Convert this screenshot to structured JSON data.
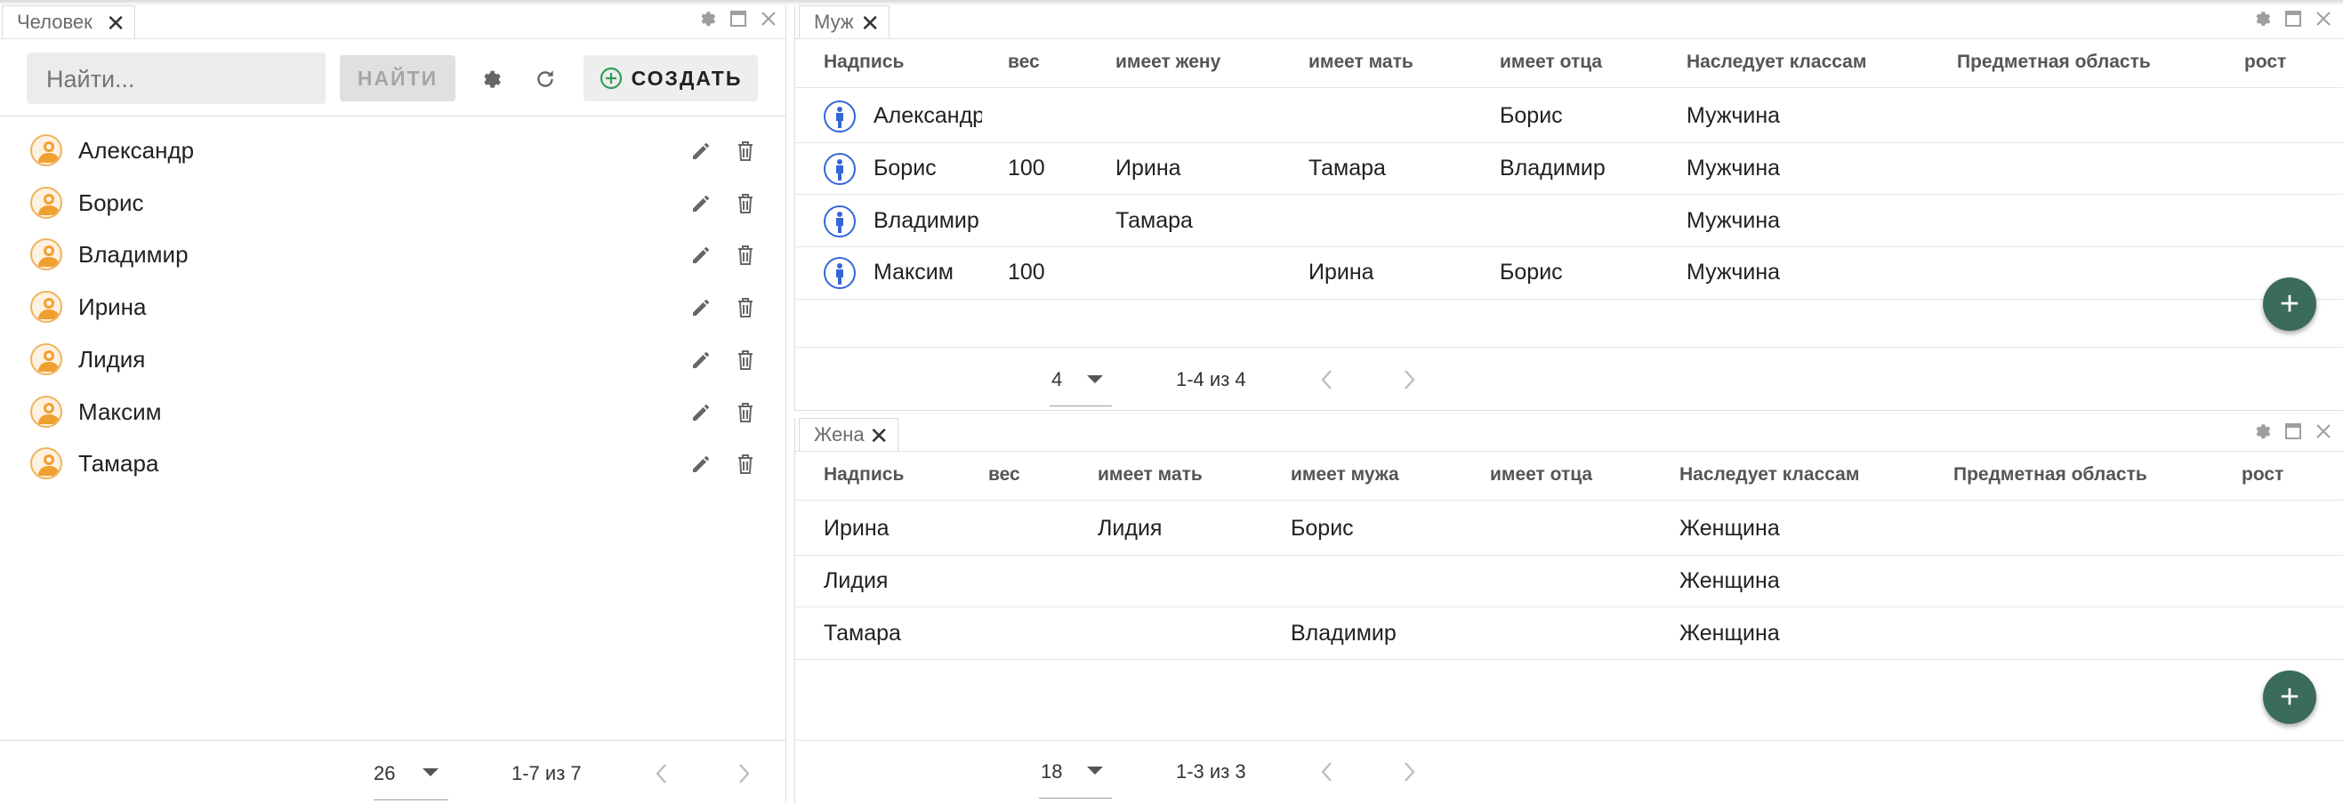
{
  "left": {
    "tab_label": "Человек",
    "search_placeholder": "Найти...",
    "find_button": "НАЙТИ",
    "create_button": "СОЗДАТЬ",
    "items": [
      "Александр",
      "Борис",
      "Владимир",
      "Ирина",
      "Лидия",
      "Максим",
      "Тамара"
    ],
    "page_size": "26",
    "range": "1-7 из 7"
  },
  "husband": {
    "tab_label": "Муж",
    "columns": [
      "Надпись",
      "вес",
      "имеет жену",
      "имеет мать",
      "имеет отца",
      "Наследует классам",
      "Предметная область",
      "рост"
    ],
    "rows": [
      {
        "name": "Александр",
        "weight": "",
        "wife": "",
        "mother": "",
        "father": "Борис",
        "class": "Мужчина"
      },
      {
        "name": "Борис",
        "weight": "100",
        "wife": "Ирина",
        "mother": "Тамара",
        "father": "Владимир",
        "class": "Мужчина"
      },
      {
        "name": "Владимир",
        "weight": "",
        "wife": "Тамара",
        "mother": "",
        "father": "",
        "class": "Мужчина"
      },
      {
        "name": "Максим",
        "weight": "100",
        "wife": "",
        "mother": "Ирина",
        "father": "Борис",
        "class": "Мужчина"
      }
    ],
    "page_size": "4",
    "range": "1-4 из 4"
  },
  "wife": {
    "tab_label": "Жена",
    "columns": [
      "Надпись",
      "вес",
      "имеет мать",
      "имеет мужа",
      "имеет отца",
      "Наследует классам",
      "Предметная область",
      "рост"
    ],
    "rows": [
      {
        "name": "Ирина",
        "weight": "",
        "mother": "Лидия",
        "husband": "Борис",
        "father": "",
        "class": "Женщина"
      },
      {
        "name": "Лидия",
        "weight": "",
        "mother": "",
        "husband": "",
        "father": "",
        "class": "Женщина"
      },
      {
        "name": "Тамара",
        "weight": "",
        "mother": "",
        "husband": "Владимир",
        "father": "",
        "class": "Женщина"
      }
    ],
    "page_size": "18",
    "range": "1-3 из 3"
  },
  "icons": {
    "person": "person-circle-icon",
    "man": "man-figure-icon",
    "edit": "pencil-icon",
    "delete": "trash-icon",
    "settings": "gear-icon",
    "refresh": "refresh-icon",
    "add": "plus-icon",
    "maximize": "maximize-icon",
    "close": "close-icon"
  },
  "colors": {
    "accent_green": "#3b6b5a",
    "create_icon": "#2e9e57",
    "person_icon": "#f0a030",
    "man_icon": "#3566d6"
  }
}
